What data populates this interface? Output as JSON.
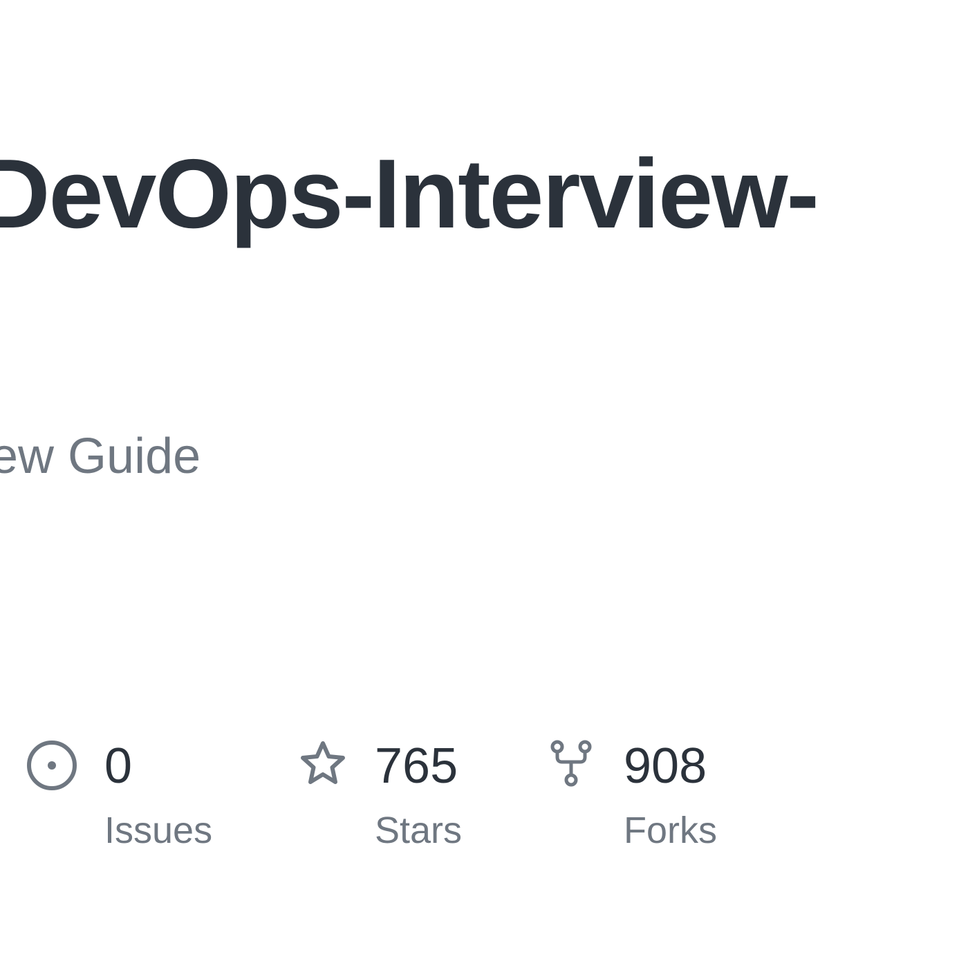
{
  "repo": {
    "title": "DevOps-Interview-",
    "description": "ew Guide"
  },
  "stats": {
    "issues": {
      "count": "0",
      "label": "Issues",
      "icon": "issue-opened-icon"
    },
    "stars": {
      "count": "765",
      "label": "Stars",
      "icon": "star-icon"
    },
    "forks": {
      "count": "908",
      "label": "Forks",
      "icon": "repo-forked-icon"
    }
  },
  "colors": {
    "text_primary": "#2b323b",
    "text_muted": "#6f7781",
    "icon": "#6f7781",
    "background": "#ffffff"
  }
}
